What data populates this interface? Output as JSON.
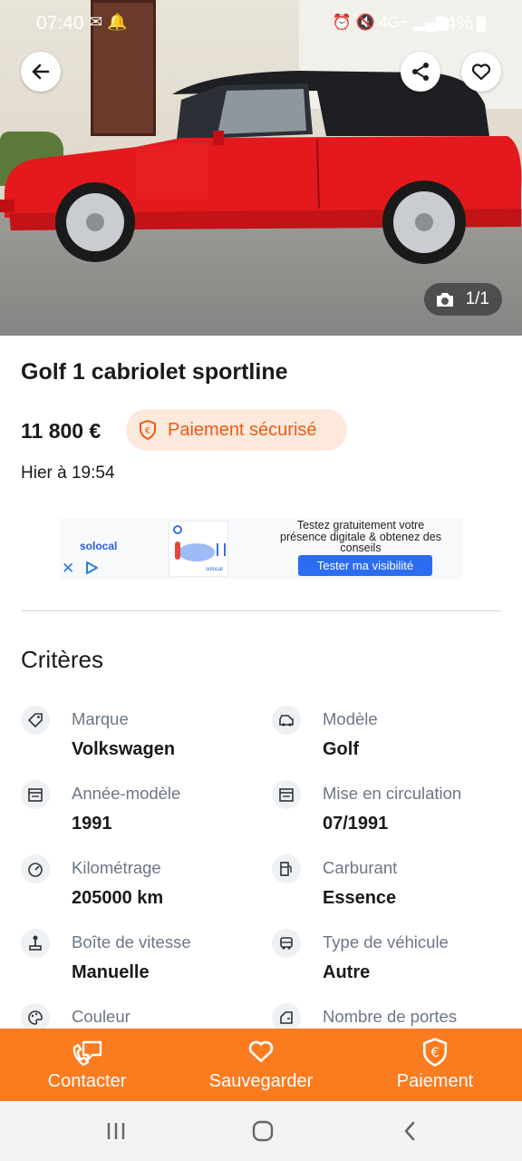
{
  "status_bar": {
    "time": "07:40",
    "battery": "94%",
    "network": "4G+",
    "icons": [
      "gmail-icon",
      "notification-bell-icon",
      "alarm-icon",
      "mute-icon",
      "signal-icon",
      "battery-icon"
    ]
  },
  "photo": {
    "counter": "1/1",
    "actions": [
      "back-arrow-icon",
      "share-icon",
      "heart-icon",
      "camera-icon"
    ]
  },
  "listing": {
    "title": "Golf 1 cabriolet sportline",
    "price": "11 800 €",
    "secure_payment": "Paiement sécurisé",
    "date": "Hier à 19:54"
  },
  "ad": {
    "brand": "solocal",
    "text": "Testez gratuitement votre présence digitale & obtenez des conseils",
    "cta": "Tester ma visibilité",
    "thumb_brand": "solocal"
  },
  "criteria": {
    "title": "Critères",
    "items": [
      {
        "label": "Marque",
        "value": "Volkswagen",
        "icon": "tag-icon"
      },
      {
        "label": "Modèle",
        "value": "Golf",
        "icon": "car-model-icon"
      },
      {
        "label": "Année-modèle",
        "value": "1991",
        "icon": "calendar-icon"
      },
      {
        "label": "Mise en circulation",
        "value": "07/1991",
        "icon": "calendar-icon"
      },
      {
        "label": "Kilométrage",
        "value": "205000 km",
        "icon": "speedometer-icon"
      },
      {
        "label": "Carburant",
        "value": "Essence",
        "icon": "fuel-pump-icon"
      },
      {
        "label": "Boîte de vitesse",
        "value": "Manuelle",
        "icon": "gear-stick-icon"
      },
      {
        "label": "Type de véhicule",
        "value": "Autre",
        "icon": "vehicle-type-icon"
      },
      {
        "label": "Couleur",
        "value": "",
        "icon": "palette-icon"
      },
      {
        "label": "Nombre de portes",
        "value": "",
        "icon": "car-door-icon"
      }
    ]
  },
  "actions": [
    {
      "label": "Contacter",
      "icon": "phone-message-icon"
    },
    {
      "label": "Sauvegarder",
      "icon": "heart-icon"
    },
    {
      "label": "Paiement",
      "icon": "euro-shield-icon"
    }
  ],
  "colors": {
    "accent_orange": "#fb7b1f",
    "badge_bg": "#fde9dc",
    "badge_text": "#ec5a13",
    "label_grey": "#6b7785",
    "car_red": "#e11b1f"
  }
}
